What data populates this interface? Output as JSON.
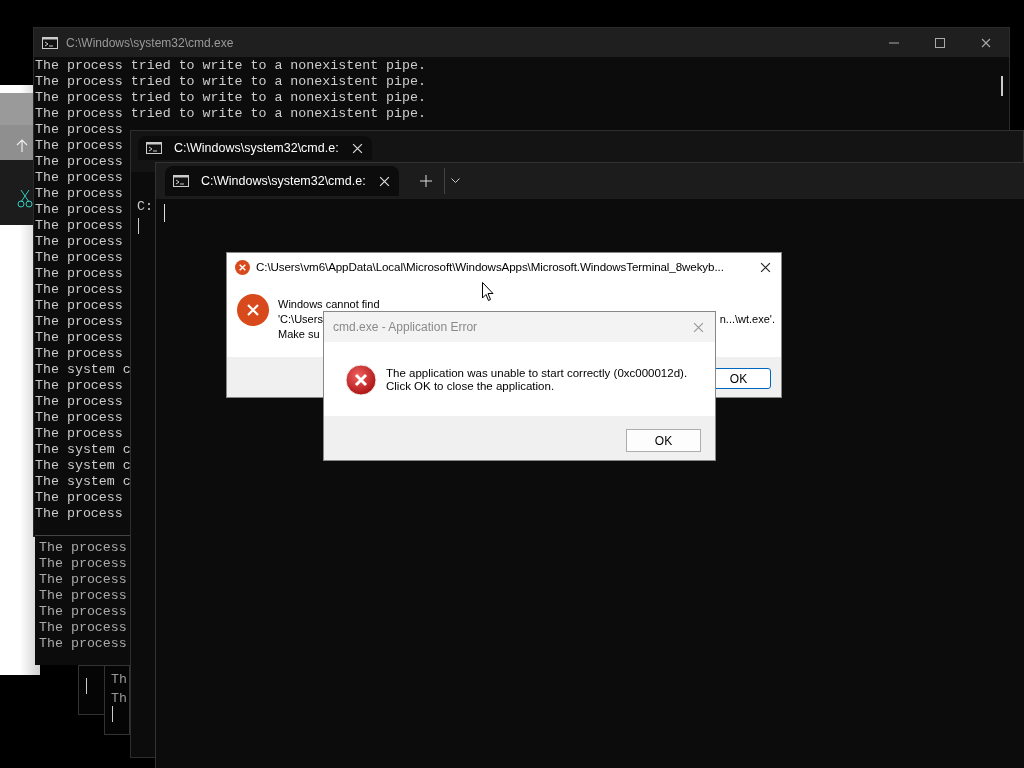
{
  "console_window": {
    "title": "C:\\Windows\\system32\\cmd.exe",
    "lines": [
      "The process tried to write to a nonexistent pipe.",
      "The process tried to write to a nonexistent pipe.",
      "The process tried to write to a nonexistent pipe.",
      "The process tried to write to a nonexistent pipe.",
      "The process",
      "The process",
      "The process",
      "The process",
      "The process",
      "The process",
      "The process",
      "The process",
      "The process",
      "The process",
      "The process",
      "The process",
      "The process",
      "The process",
      "The process",
      "The system c",
      "The process",
      "The process",
      "The process",
      "The process",
      "The system c",
      "The system c",
      "The system c",
      "The process",
      "The process"
    ]
  },
  "ghost_console": {
    "lines": [
      "The process",
      "The process",
      "The process",
      "The process",
      "The process",
      "The process",
      "The process"
    ]
  },
  "ghost_fragment": {
    "lines": [
      "Th",
      "Th"
    ]
  },
  "terminal_back": {
    "tab_title": "C:\\Windows\\system32\\cmd.e:",
    "prompt": "C:"
  },
  "terminal_front": {
    "tab_title": "C:\\Windows\\system32\\cmd.e:"
  },
  "error_dialog": {
    "title": "C:\\Users\\vm6\\AppData\\Local\\Microsoft\\WindowsApps\\Microsoft.WindowsTerminal_8wekyb...",
    "line_1": "Windows cannot find",
    "line_2_start": "'C:\\Users",
    "line_2_end": "n...\\wt.exe'.",
    "line_3": "Make su",
    "button": "OK"
  },
  "app_error_dialog": {
    "title": "cmd.exe - Application Error",
    "message_lines": [
      "The application was unable to start correctly (0xc000012d).",
      "Click OK to close the application."
    ],
    "button": "OK"
  }
}
